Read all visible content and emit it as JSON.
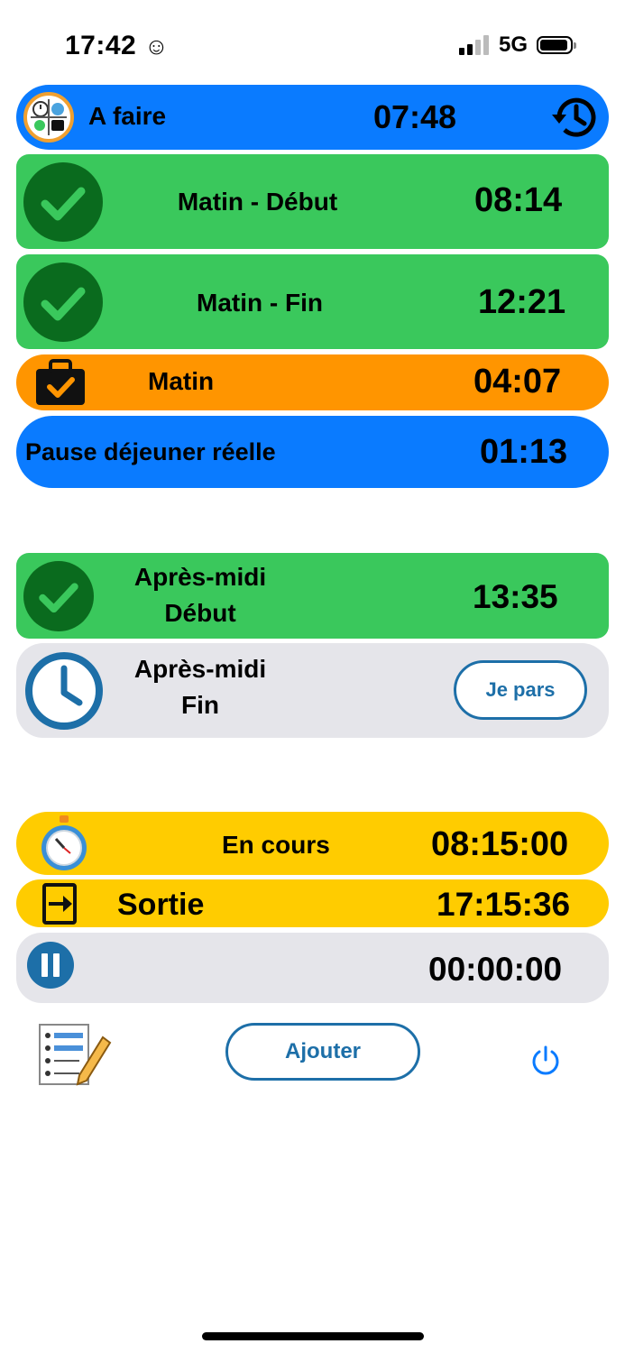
{
  "status_bar": {
    "time": "17:42",
    "network": "5G"
  },
  "todo": {
    "label": "A faire",
    "value": "07:48"
  },
  "morning_start": {
    "label": "Matin - Début",
    "value": "08:14"
  },
  "morning_end": {
    "label": "Matin - Fin",
    "value": "12:21"
  },
  "morning_total": {
    "label": "Matin",
    "value": "04:07"
  },
  "lunch": {
    "label": "Pause déjeuner réelle",
    "value": "01:13"
  },
  "afternoon_start": {
    "label_line1": "Après-midi",
    "label_line2": "Début",
    "value": "13:35"
  },
  "afternoon_end": {
    "label_line1": "Après-midi",
    "label_line2": "Fin",
    "button": "Je pars"
  },
  "in_progress": {
    "label": "En cours",
    "value": "08:15:00"
  },
  "exit": {
    "label": "Sortie",
    "value": "17:15:36"
  },
  "pause": {
    "value": "00:00:00"
  },
  "bottom": {
    "add_button": "Ajouter"
  },
  "colors": {
    "blue": "#0a7bff",
    "green": "#3ac85c",
    "orange": "#ff9500",
    "grey": "#e5e5ea",
    "yellow": "#ffcc00",
    "dark_green": "#0a6b1e",
    "button_blue": "#1d6fa8"
  }
}
